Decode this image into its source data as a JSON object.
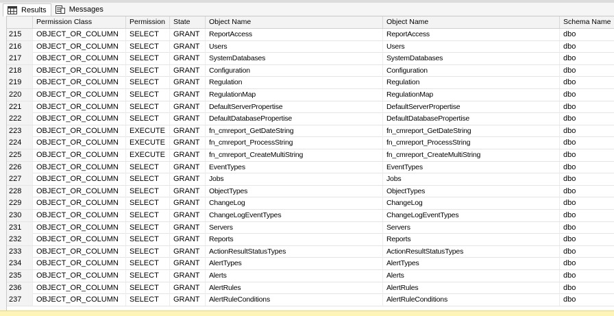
{
  "tabs": [
    {
      "label": "Results",
      "icon": "grid-icon"
    },
    {
      "label": "Messages",
      "icon": "messages-icon"
    }
  ],
  "columns": [
    "",
    "Permission Class",
    "Permission",
    "State",
    "Object Name",
    "Object Name",
    "Schema Name"
  ],
  "rows": [
    [
      "215",
      "OBJECT_OR_COLUMN",
      "SELECT",
      "GRANT",
      "ReportAccess",
      "ReportAccess",
      "dbo"
    ],
    [
      "216",
      "OBJECT_OR_COLUMN",
      "SELECT",
      "GRANT",
      "Users",
      "Users",
      "dbo"
    ],
    [
      "217",
      "OBJECT_OR_COLUMN",
      "SELECT",
      "GRANT",
      "SystemDatabases",
      "SystemDatabases",
      "dbo"
    ],
    [
      "218",
      "OBJECT_OR_COLUMN",
      "SELECT",
      "GRANT",
      "Configuration",
      "Configuration",
      "dbo"
    ],
    [
      "219",
      "OBJECT_OR_COLUMN",
      "SELECT",
      "GRANT",
      "Regulation",
      "Regulation",
      "dbo"
    ],
    [
      "220",
      "OBJECT_OR_COLUMN",
      "SELECT",
      "GRANT",
      "RegulationMap",
      "RegulationMap",
      "dbo"
    ],
    [
      "221",
      "OBJECT_OR_COLUMN",
      "SELECT",
      "GRANT",
      "DefaultServerPropertise",
      "DefaultServerPropertise",
      "dbo"
    ],
    [
      "222",
      "OBJECT_OR_COLUMN",
      "SELECT",
      "GRANT",
      "DefaultDatabasePropertise",
      "DefaultDatabasePropertise",
      "dbo"
    ],
    [
      "223",
      "OBJECT_OR_COLUMN",
      "EXECUTE",
      "GRANT",
      "fn_cmreport_GetDateString",
      "fn_cmreport_GetDateString",
      "dbo"
    ],
    [
      "224",
      "OBJECT_OR_COLUMN",
      "EXECUTE",
      "GRANT",
      "fn_cmreport_ProcessString",
      "fn_cmreport_ProcessString",
      "dbo"
    ],
    [
      "225",
      "OBJECT_OR_COLUMN",
      "EXECUTE",
      "GRANT",
      "fn_cmreport_CreateMultiString",
      "fn_cmreport_CreateMultiString",
      "dbo"
    ],
    [
      "226",
      "OBJECT_OR_COLUMN",
      "SELECT",
      "GRANT",
      "EventTypes",
      "EventTypes",
      "dbo"
    ],
    [
      "227",
      "OBJECT_OR_COLUMN",
      "SELECT",
      "GRANT",
      "Jobs",
      "Jobs",
      "dbo"
    ],
    [
      "228",
      "OBJECT_OR_COLUMN",
      "SELECT",
      "GRANT",
      "ObjectTypes",
      "ObjectTypes",
      "dbo"
    ],
    [
      "229",
      "OBJECT_OR_COLUMN",
      "SELECT",
      "GRANT",
      "ChangeLog",
      "ChangeLog",
      "dbo"
    ],
    [
      "230",
      "OBJECT_OR_COLUMN",
      "SELECT",
      "GRANT",
      "ChangeLogEventTypes",
      "ChangeLogEventTypes",
      "dbo"
    ],
    [
      "231",
      "OBJECT_OR_COLUMN",
      "SELECT",
      "GRANT",
      "Servers",
      "Servers",
      "dbo"
    ],
    [
      "232",
      "OBJECT_OR_COLUMN",
      "SELECT",
      "GRANT",
      "Reports",
      "Reports",
      "dbo"
    ],
    [
      "233",
      "OBJECT_OR_COLUMN",
      "SELECT",
      "GRANT",
      "ActionResultStatusTypes",
      "ActionResultStatusTypes",
      "dbo"
    ],
    [
      "234",
      "OBJECT_OR_COLUMN",
      "SELECT",
      "GRANT",
      "AlertTypes",
      "AlertTypes",
      "dbo"
    ],
    [
      "235",
      "OBJECT_OR_COLUMN",
      "SELECT",
      "GRANT",
      "Alerts",
      "Alerts",
      "dbo"
    ],
    [
      "236",
      "OBJECT_OR_COLUMN",
      "SELECT",
      "GRANT",
      "AlertRules",
      "AlertRules",
      "dbo"
    ],
    [
      "237",
      "OBJECT_OR_COLUMN",
      "SELECT",
      "GRANT",
      "AlertRuleConditions",
      "AlertRuleConditions",
      "dbo"
    ]
  ],
  "colors": {
    "header_bg": "#f3f3f3",
    "status_bar": "#fff4b8"
  }
}
